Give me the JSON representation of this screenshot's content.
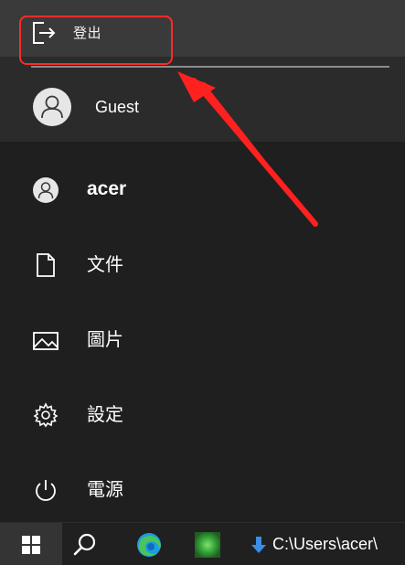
{
  "account_menu": {
    "sign_out_label": "登出",
    "other_user_name": "Guest"
  },
  "side_list": {
    "items": [
      {
        "label": "acer",
        "icon": "user-avatar-icon"
      },
      {
        "label": "文件",
        "icon": "document-icon"
      },
      {
        "label": "圖片",
        "icon": "pictures-icon"
      },
      {
        "label": "設定",
        "icon": "gear-icon"
      },
      {
        "label": "電源",
        "icon": "power-icon"
      }
    ]
  },
  "taskbar": {
    "pinned": [
      {
        "name": "start",
        "icon": "windows-logo-icon"
      },
      {
        "name": "search",
        "icon": "search-icon"
      },
      {
        "name": "edge",
        "icon": "edge-icon"
      },
      {
        "name": "green-app",
        "icon": "green-app-icon"
      }
    ],
    "download_path": "C:\\Users\\acer\\"
  },
  "colors": {
    "menu_bg": "#1f1f1f",
    "flyout_bg": "#2b2b2b",
    "signout_bg": "#3a3a3a",
    "taskbar_bg": "#202020",
    "annotation": "#ff2a2a",
    "download_arrow": "#3a8ee6"
  }
}
